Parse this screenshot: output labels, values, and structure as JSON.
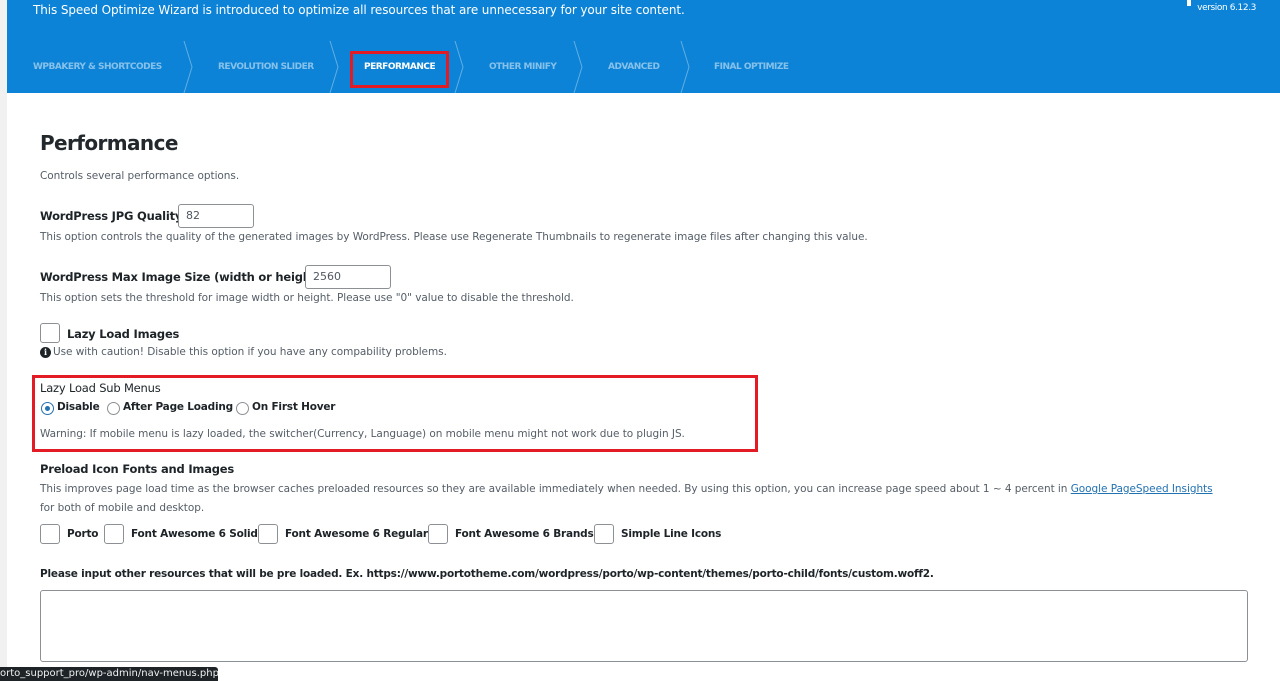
{
  "header": {
    "intro": "This Speed Optimize Wizard is introduced to optimize all resources that are unnecessary for your site content.",
    "version": "version 6.12.3",
    "bg_color": "#0c83d6"
  },
  "tabs": [
    {
      "label": "WPBAKERY & SHORTCODES",
      "active": false
    },
    {
      "label": "REVOLUTION SLIDER",
      "active": false
    },
    {
      "label": "PERFORMANCE",
      "active": true
    },
    {
      "label": "OTHER MINIFY",
      "active": false
    },
    {
      "label": "ADVANCED",
      "active": false
    },
    {
      "label": "FINAL OPTIMIZE",
      "active": false
    }
  ],
  "page": {
    "title": "Performance",
    "subtitle": "Controls several performance options."
  },
  "jpg_quality": {
    "label": "WordPress JPG Quality",
    "value": "82",
    "help": "This option controls the quality of the generated images by WordPress. Please use Regenerate Thumbnails to regenerate image files after changing this value."
  },
  "max_image": {
    "label": "WordPress Max Image Size (width or height)",
    "value": "2560",
    "help": "This option sets the threshold for image width or height. Please use \"0\" value to disable the threshold."
  },
  "lazy_images": {
    "label": "Lazy Load Images",
    "checked": false,
    "help": "Use with caution! Disable this option if you have any compability problems."
  },
  "lazy_menus": {
    "label": "Lazy Load Sub Menus",
    "options": [
      "Disable",
      "After Page Loading",
      "On First Hover"
    ],
    "selected": "Disable",
    "warning": "Warning: If mobile menu is lazy loaded, the switcher(Currency, Language) on mobile menu might not work due to plugin JS."
  },
  "preload": {
    "label": "Preload Icon Fonts and Images",
    "help_part1": "This improves page load time as the browser caches preloaded resources so they are available immediately when needed. By using this option, you can increase page speed about 1 ~ 4 percent in",
    "help_link": "Google PageSpeed Insights",
    "help_part2": "for both of mobile and desktop.",
    "fonts": [
      "Porto",
      "Font Awesome 6 Solid",
      "Font Awesome 6 Regular",
      "Font Awesome 6 Brands",
      "Simple Line Icons"
    ],
    "other_label": "Please input other resources that will be pre loaded. Ex. https://www.portotheme.com/wordpress/porto/wp-content/themes/porto-child/fonts/custom.woff2.",
    "other_value": ""
  },
  "statusbar": {
    "url": "orto_support_pro/wp-admin/nav-menus.php"
  },
  "colors": {
    "highlight": "#e21b24",
    "link": "#2271b1"
  }
}
